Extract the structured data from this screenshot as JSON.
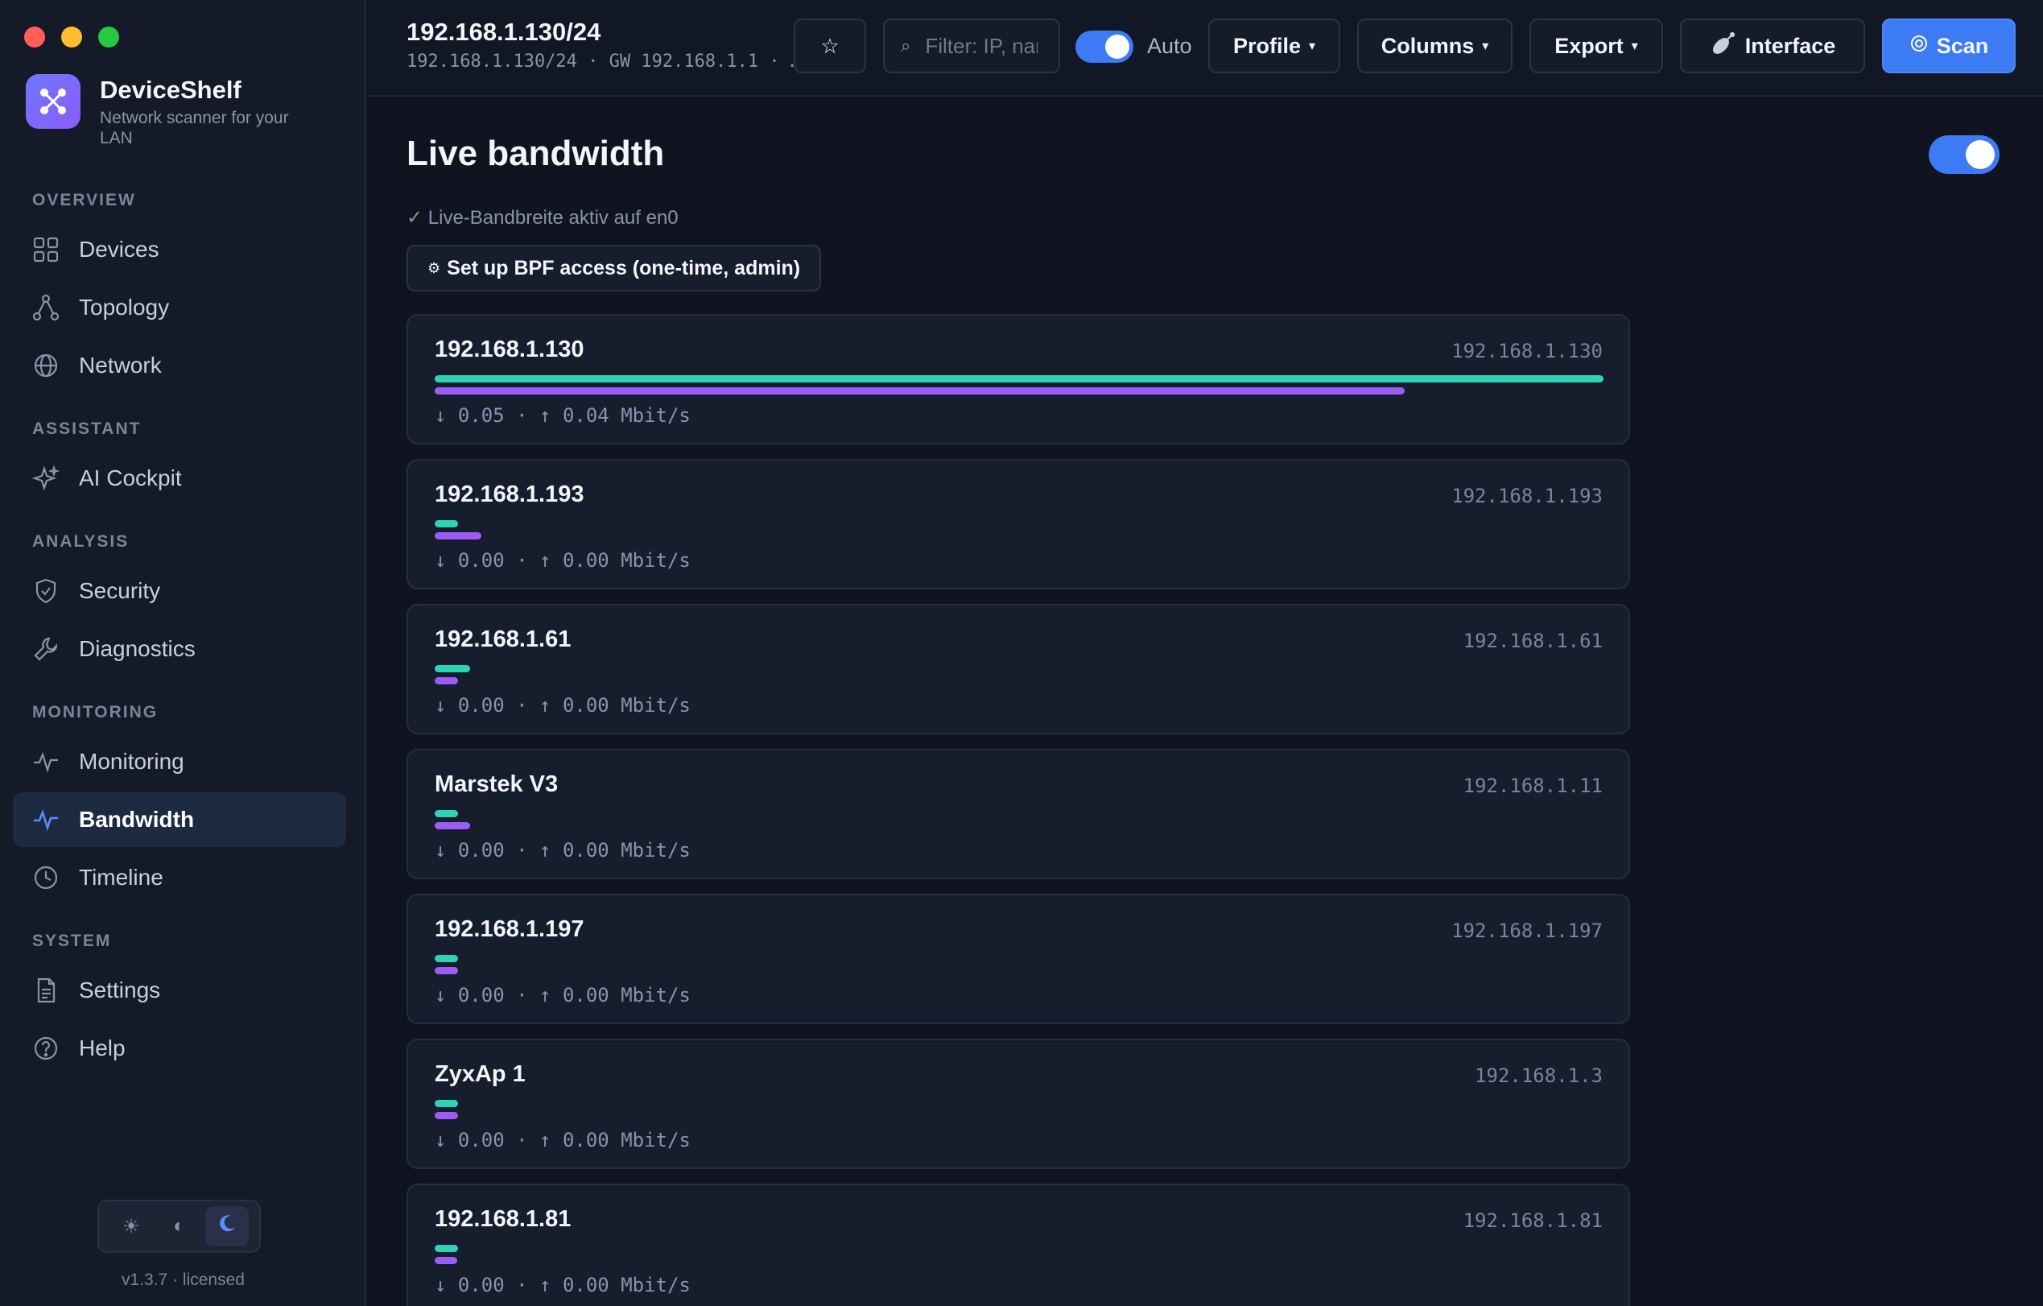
{
  "app": {
    "name": "DeviceShelf",
    "tagline": "Network scanner for your LAN",
    "version": "v1.3.7 · licensed"
  },
  "sidebar": {
    "sections": [
      {
        "label": "OVERVIEW"
      },
      {
        "label": "ASSISTANT"
      },
      {
        "label": "ANALYSIS"
      },
      {
        "label": "MONITORING"
      },
      {
        "label": "SYSTEM"
      }
    ],
    "items": [
      {
        "label": "Devices",
        "icon": "grid-icon"
      },
      {
        "label": "Topology",
        "icon": "topology-icon"
      },
      {
        "label": "Network",
        "icon": "globe-icon"
      },
      {
        "label": "AI Cockpit",
        "icon": "sparkle-icon"
      },
      {
        "label": "Security",
        "icon": "shield-icon"
      },
      {
        "label": "Diagnostics",
        "icon": "wrench-icon"
      },
      {
        "label": "Monitoring",
        "icon": "pulse-icon"
      },
      {
        "label": "Bandwidth",
        "icon": "pulse-icon",
        "active": true
      },
      {
        "label": "Timeline",
        "icon": "clock-icon"
      },
      {
        "label": "Settings",
        "icon": "document-icon"
      },
      {
        "label": "Help",
        "icon": "help-icon"
      }
    ],
    "theme": {
      "selected": "dark"
    }
  },
  "topbar": {
    "subnet_title": "192.168.1.130/24",
    "subnet_sub": "192.168.1.130/24 · GW 192.168.1.1 · …",
    "search_placeholder": "Filter: IP, name",
    "auto_label": "Auto",
    "auto_enabled": true,
    "profile_label": "Profile",
    "columns_label": "Columns",
    "export_label": "Export",
    "interface_label": "Interface",
    "scan_label": "Scan"
  },
  "main": {
    "title": "Live bandwidth",
    "live_enabled": true,
    "status": "✓ Live-Bandbreite aktiv auf en0",
    "bpf_button": "Set up BPF access (one-time, admin)",
    "devices": [
      {
        "name": "192.168.1.130",
        "ip": "192.168.1.130",
        "rates": "↓ 0.05 · ↑ 0.04 Mbit/s",
        "down_fraction": 1.0,
        "up_fraction": 0.83
      },
      {
        "name": "192.168.1.193",
        "ip": "192.168.1.193",
        "rates": "↓ 0.00 · ↑ 0.00 Mbit/s",
        "down_fraction": 0.02,
        "up_fraction": 0.04
      },
      {
        "name": "192.168.1.61",
        "ip": "192.168.1.61",
        "rates": "↓ 0.00 · ↑ 0.00 Mbit/s",
        "down_fraction": 0.03,
        "up_fraction": 0.02
      },
      {
        "name": "Marstek V3",
        "ip": "192.168.1.11",
        "rates": "↓ 0.00 · ↑ 0.00 Mbit/s",
        "down_fraction": 0.02,
        "up_fraction": 0.03
      },
      {
        "name": "192.168.1.197",
        "ip": "192.168.1.197",
        "rates": "↓ 0.00 · ↑ 0.00 Mbit/s",
        "down_fraction": 0.02,
        "up_fraction": 0.02
      },
      {
        "name": "ZyxAp 1",
        "ip": "192.168.1.3",
        "rates": "↓ 0.00 · ↑ 0.00 Mbit/s",
        "down_fraction": 0.02,
        "up_fraction": 0.02
      },
      {
        "name": "192.168.1.81",
        "ip": "192.168.1.81",
        "rates": "↓ 0.00 · ↑ 0.00 Mbit/s",
        "down_fraction": 0.02,
        "up_fraction": 0.01
      }
    ]
  },
  "colors": {
    "accent": "#3d7bf5",
    "download_bar": "#2ed3b7",
    "upload_bar": "#9b5cf6"
  }
}
